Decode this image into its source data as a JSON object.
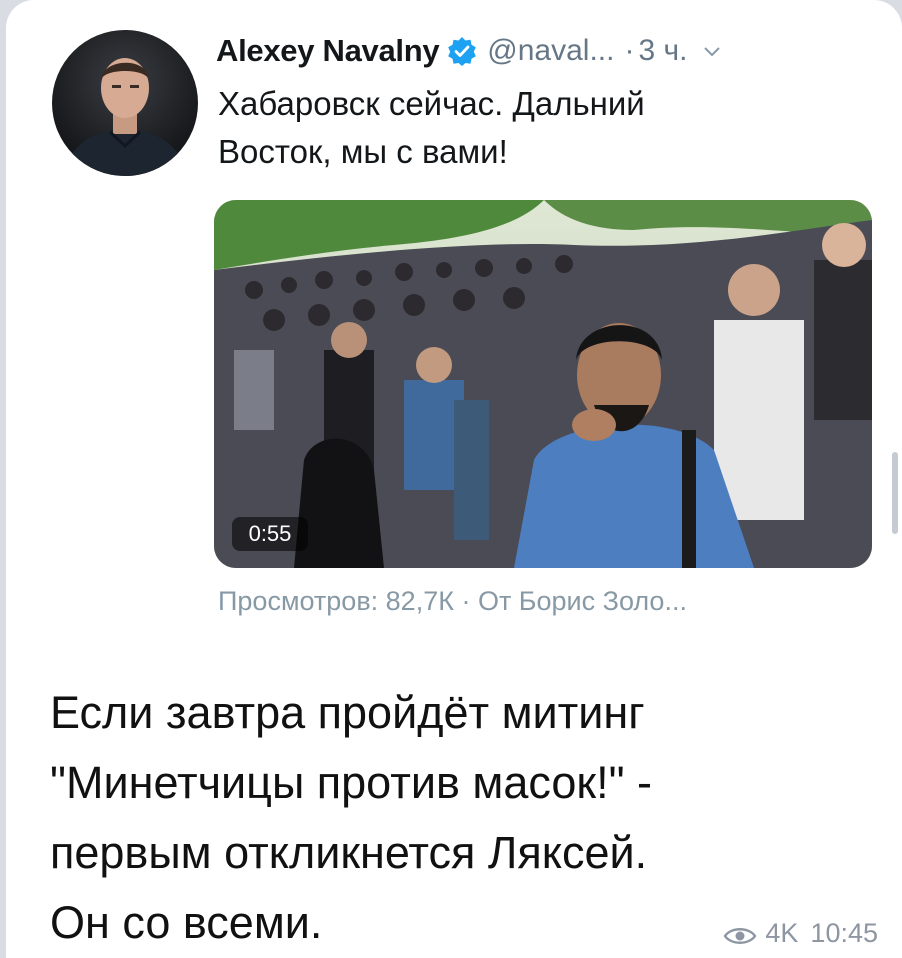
{
  "tweet": {
    "author_name": "Alexey Navalny",
    "handle": "@naval...",
    "separator": "·",
    "time": "3 ч.",
    "text_lines": [
      "Хабаровск сейчас. Дальний",
      "Восток, мы с вами!"
    ],
    "video": {
      "duration": "0:55"
    },
    "views_line": "Просмотров: 82,7К · От Борис Золо..."
  },
  "post": {
    "caption_lines": [
      "Если завтра пройдёт митинг",
      "\"Минетчицы против масок!\" -",
      "первым откликнется Ляксей.",
      "Он со всеми."
    ],
    "views": "4K",
    "time": "10:45"
  },
  "colors": {
    "verified": "#1da1f2",
    "text": "#14171a",
    "secondary": "#657786",
    "meta": "#8e96a3"
  },
  "icons": {
    "verified": "verified-badge-icon",
    "chevron": "chevron-down-icon",
    "eye": "eye-icon"
  }
}
